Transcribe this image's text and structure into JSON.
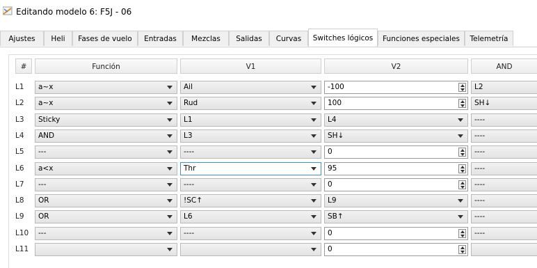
{
  "window": {
    "title": "Editando modelo 6: F5J - 06",
    "icon": "app-logo-icon"
  },
  "tabs": [
    {
      "label": "Ajustes"
    },
    {
      "label": "Heli"
    },
    {
      "label": "Fases de vuelo"
    },
    {
      "label": "Entradas"
    },
    {
      "label": "Mezclas"
    },
    {
      "label": "Salidas"
    },
    {
      "label": "Curvas"
    },
    {
      "label": "Switches lógicos",
      "active": true
    },
    {
      "label": "Funciones especiales"
    },
    {
      "label": "Telemetría"
    }
  ],
  "grid": {
    "headers": {
      "num": "#",
      "func": "Función",
      "v1": "V1",
      "v2": "V2",
      "and": "AND"
    },
    "rows": [
      {
        "label": "L1",
        "func": "a~x",
        "v1": "Ail",
        "v2": "-100",
        "v2_type": "spin",
        "and": "L2"
      },
      {
        "label": "L2",
        "func": "a~x",
        "v1": "Rud",
        "v2": "100",
        "v2_type": "spin",
        "and": "SH↓"
      },
      {
        "label": "L3",
        "func": "Sticky",
        "v1": "L1",
        "v2": "L4",
        "v2_type": "combo",
        "and": "----"
      },
      {
        "label": "L4",
        "func": "AND",
        "v1": "L3",
        "v2": "SH↓",
        "v2_type": "combo",
        "and": "----"
      },
      {
        "label": "L5",
        "func": "---",
        "v1": "----",
        "v2": "0",
        "v2_type": "spin",
        "and": "----"
      },
      {
        "label": "L6",
        "func": "a<x",
        "v1": "Thr",
        "v2": "95",
        "v2_type": "spin",
        "and": "----",
        "v1_focus": true
      },
      {
        "label": "L7",
        "func": "---",
        "v1": "----",
        "v2": "0",
        "v2_type": "spin",
        "and": "----"
      },
      {
        "label": "L8",
        "func": "OR",
        "v1": "!SC↑",
        "v2": "L9",
        "v2_type": "combo",
        "and": "----"
      },
      {
        "label": "L9",
        "func": "OR",
        "v1": "L6",
        "v2": "SB↑",
        "v2_type": "combo",
        "and": "----"
      },
      {
        "label": "L10",
        "func": "---",
        "v1": "----",
        "v2": "0",
        "v2_type": "spin",
        "and": "----"
      },
      {
        "label": "L11",
        "func": "",
        "v1": "",
        "v2": "0",
        "v2_type": "spin",
        "and": ""
      }
    ]
  }
}
